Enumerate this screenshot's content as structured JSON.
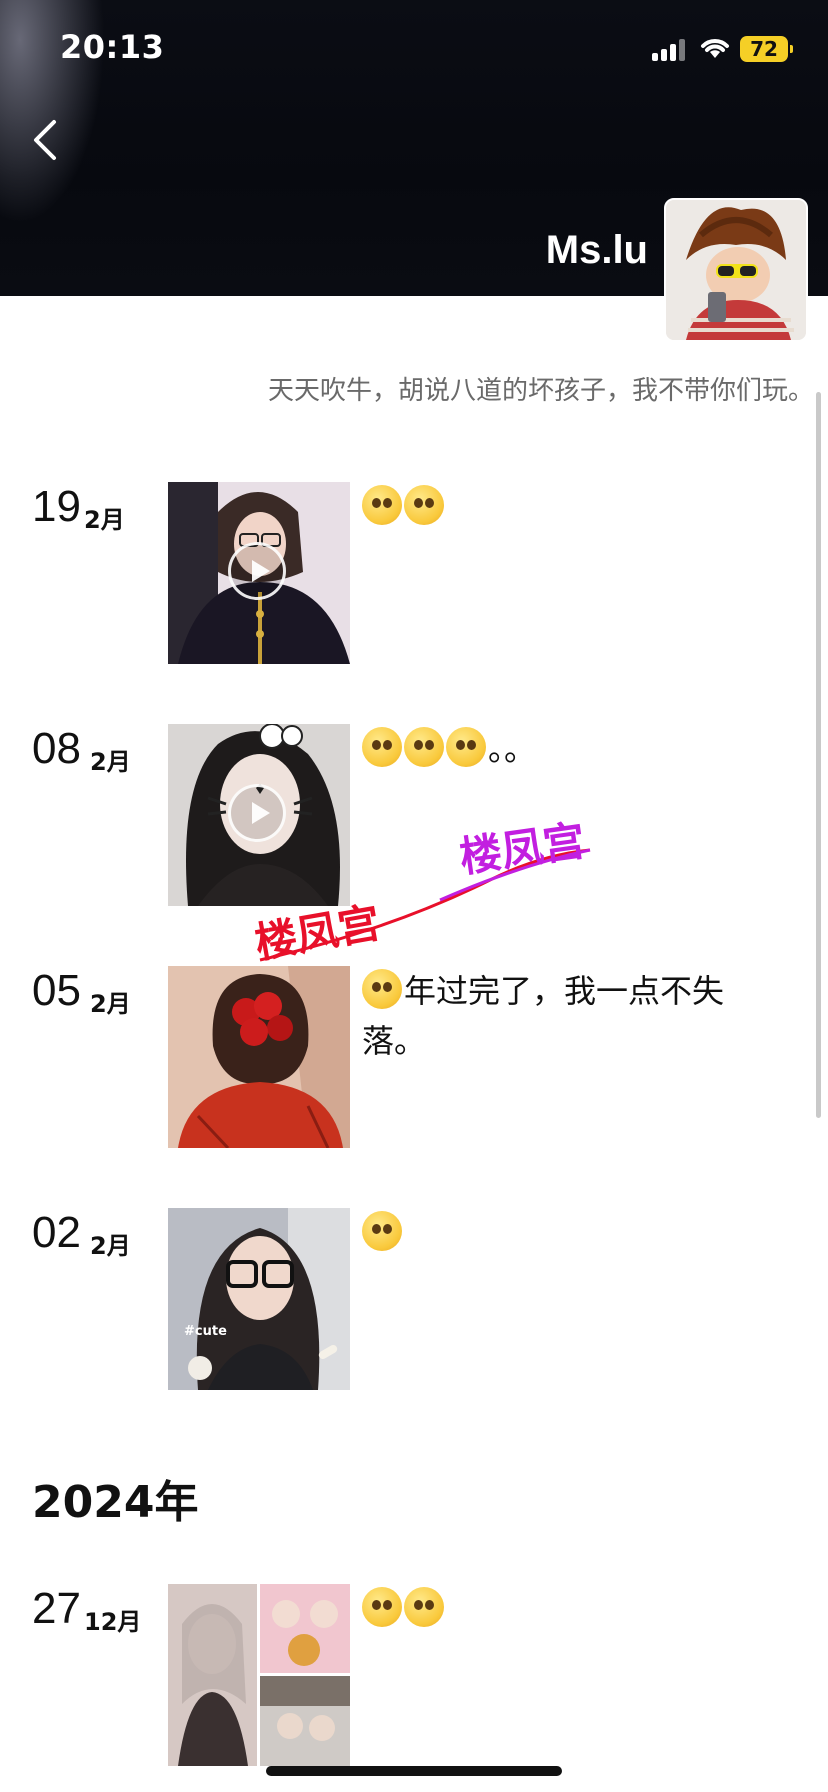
{
  "status_bar": {
    "time": "20:13",
    "battery": "72"
  },
  "profile": {
    "name": "Ms.lu",
    "signature": "天天吹牛，胡说八道的坏孩子，我不带你们玩。"
  },
  "posts": [
    {
      "day": "19",
      "month": "2月",
      "text": "",
      "video": true
    },
    {
      "day": "08",
      "month": "2月",
      "text": "。。",
      "video": true
    },
    {
      "day": "05",
      "month": "2月",
      "text": "年过完了，我一点不失落。",
      "video": false
    },
    {
      "day": "02",
      "month": "2月",
      "text": "",
      "video": false
    }
  ],
  "year_divider": "2024年",
  "post_2024": {
    "day": "27",
    "month": "12月",
    "text": ""
  },
  "watermark": {
    "text": "楼凤宫"
  },
  "thumb_tag": "#cute",
  "colors": {
    "battery": "#f5cf26",
    "watermark_red": "#e8102a",
    "watermark_purple": "#c21fe0"
  }
}
